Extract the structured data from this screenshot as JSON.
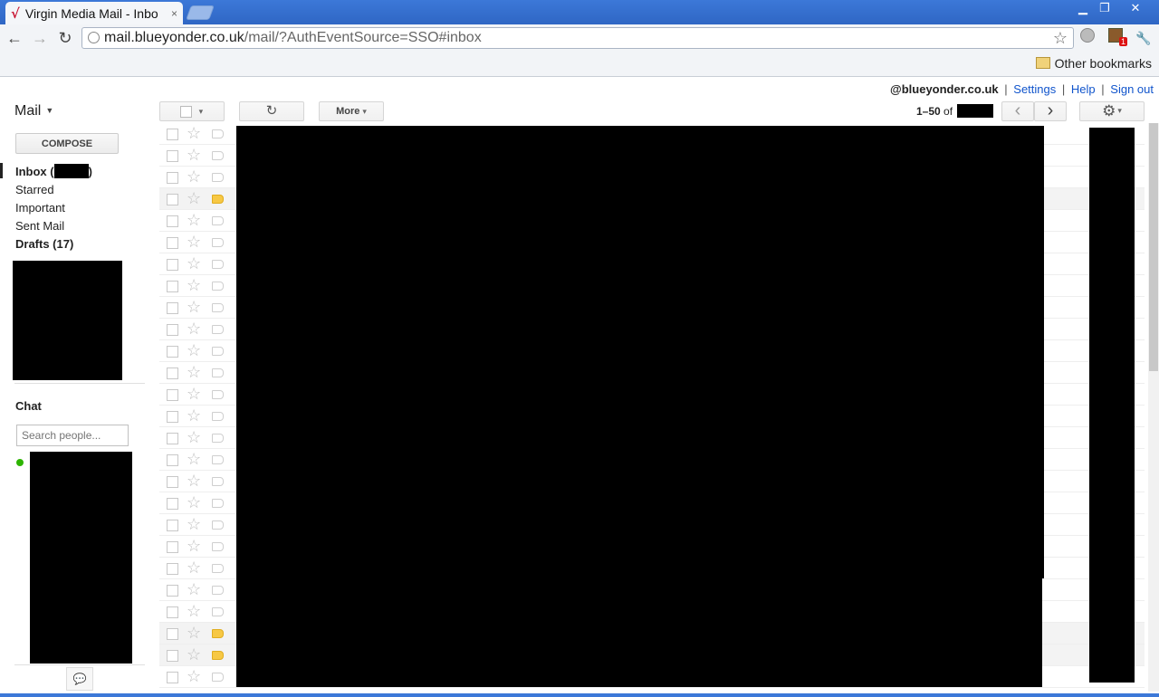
{
  "browser": {
    "tab_title": "Virgin Media Mail - Inbo",
    "tab_close": "×",
    "url_host": "mail.blueyonder.co.uk",
    "url_path": "/mail/?AuthEventSource=SSO#inbox",
    "bookmarks_other": "Other bookmarks",
    "win_min": "▁",
    "win_restore": "❐",
    "win_close": "✕",
    "back": "←",
    "forward": "→",
    "reload": "↻",
    "star": "☆",
    "ext_badge": "1",
    "wrench": "🔧"
  },
  "userbar": {
    "account": "@blueyonder.co.uk",
    "settings": "Settings",
    "help": "Help",
    "signout": "Sign out",
    "sep": "|"
  },
  "nav": {
    "mail_label": "Mail",
    "mail_caret": "▼",
    "compose": "COMPOSE",
    "inbox_prefix": "Inbox (",
    "inbox_suffix": ")",
    "starred": "Starred",
    "important": "Important",
    "sent": "Sent Mail",
    "drafts": "Drafts (17)"
  },
  "chat": {
    "heading": "Chat",
    "search_placeholder": "Search people...",
    "chat_icon": "💬"
  },
  "actions": {
    "select_caret": "▾",
    "refresh": "↻",
    "more": "More",
    "more_caret": "▾",
    "pager_range": "1–50",
    "pager_of": "of",
    "prev": "‹",
    "next": "›",
    "gear": "⚙",
    "gear_caret": "▾"
  },
  "messages": {
    "star_glyph": "☆",
    "rows": [
      {
        "important": false,
        "highlight": false
      },
      {
        "important": false,
        "highlight": false
      },
      {
        "important": false,
        "highlight": false
      },
      {
        "important": true,
        "highlight": true
      },
      {
        "important": false,
        "highlight": false
      },
      {
        "important": false,
        "highlight": false
      },
      {
        "important": false,
        "highlight": false
      },
      {
        "important": false,
        "highlight": false
      },
      {
        "important": false,
        "highlight": false
      },
      {
        "important": false,
        "highlight": false
      },
      {
        "important": false,
        "highlight": false
      },
      {
        "important": false,
        "highlight": false
      },
      {
        "important": false,
        "highlight": false
      },
      {
        "important": false,
        "highlight": false
      },
      {
        "important": false,
        "highlight": false
      },
      {
        "important": false,
        "highlight": false
      },
      {
        "important": false,
        "highlight": false
      },
      {
        "important": false,
        "highlight": false
      },
      {
        "important": false,
        "highlight": false
      },
      {
        "important": false,
        "highlight": false
      },
      {
        "important": false,
        "highlight": false
      },
      {
        "important": false,
        "highlight": false
      },
      {
        "important": false,
        "highlight": false
      },
      {
        "important": true,
        "highlight": true
      },
      {
        "important": true,
        "highlight": true
      },
      {
        "important": false,
        "highlight": false
      }
    ]
  }
}
